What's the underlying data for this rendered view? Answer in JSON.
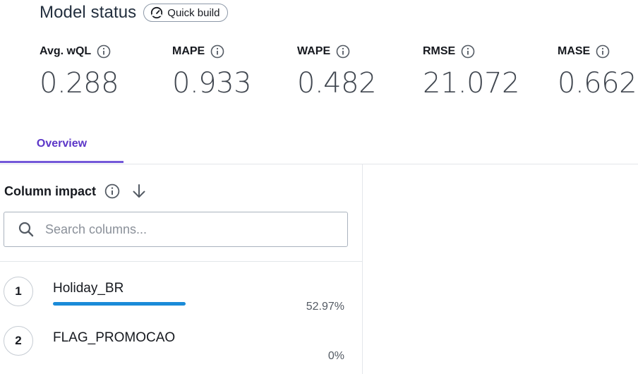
{
  "header": {
    "title": "Model status",
    "badge_label": "Quick build"
  },
  "metrics": [
    {
      "label": "Avg. wQL",
      "value": "0.288"
    },
    {
      "label": "MAPE",
      "value": "0.933"
    },
    {
      "label": "WAPE",
      "value": "0.482"
    },
    {
      "label": "RMSE",
      "value": "21.072"
    },
    {
      "label": "MASE",
      "value": "0.662"
    }
  ],
  "tabs": [
    {
      "label": "Overview",
      "active": true
    }
  ],
  "column_impact": {
    "title": "Column impact",
    "search_placeholder": "Search columns...",
    "items": [
      {
        "rank": "1",
        "name": "Holiday_BR",
        "percent_label": "52.97%",
        "fraction": 0.5297
      },
      {
        "rank": "2",
        "name": "FLAG_PROMOCAO",
        "percent_label": "0%",
        "fraction": 0
      }
    ]
  },
  "colors": {
    "accent": "#5c36c8",
    "tab_underline": "#7358d9",
    "impact_bar": "#1b8bd8"
  },
  "icons": {
    "badge": "speedometer-icon",
    "info": "info-icon",
    "sort": "arrow-down-icon",
    "search": "search-icon"
  }
}
